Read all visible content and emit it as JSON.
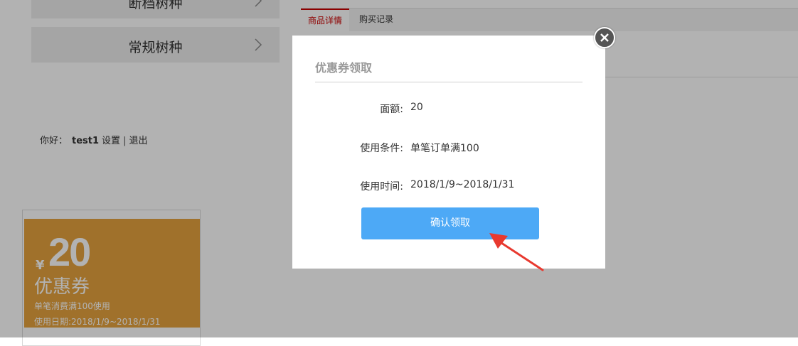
{
  "categories": [
    {
      "label": "断档树种"
    },
    {
      "label": "常规树种"
    }
  ],
  "greeting": {
    "prefix": "你好：",
    "username": "test1",
    "settings_link": "设置",
    "separator": "|",
    "logout_link": "退出"
  },
  "coupon": {
    "currency_symbol": "¥",
    "amount": "20",
    "title": "优惠券",
    "condition": "单笔消费满100使用",
    "date": "使用日期:2018/1/9~2018/1/31",
    "color": "#e6a33e"
  },
  "tabs": [
    {
      "label": "商品详情",
      "active": true
    },
    {
      "label": "购买记录",
      "active": false
    }
  ],
  "modal": {
    "title": "优惠券领取",
    "face_label": "面额:",
    "face_value": "20",
    "condition_label": "使用条件:",
    "condition_value": "单笔订单满100",
    "time_label": "使用时间:",
    "time_value": "2018/1/9~2018/1/31",
    "confirm_label": "确认领取",
    "button_color": "#4da9f6",
    "close_icon": "close-icon"
  },
  "annotation": {
    "icon": "red-arrow-icon",
    "color": "#e8392f"
  }
}
